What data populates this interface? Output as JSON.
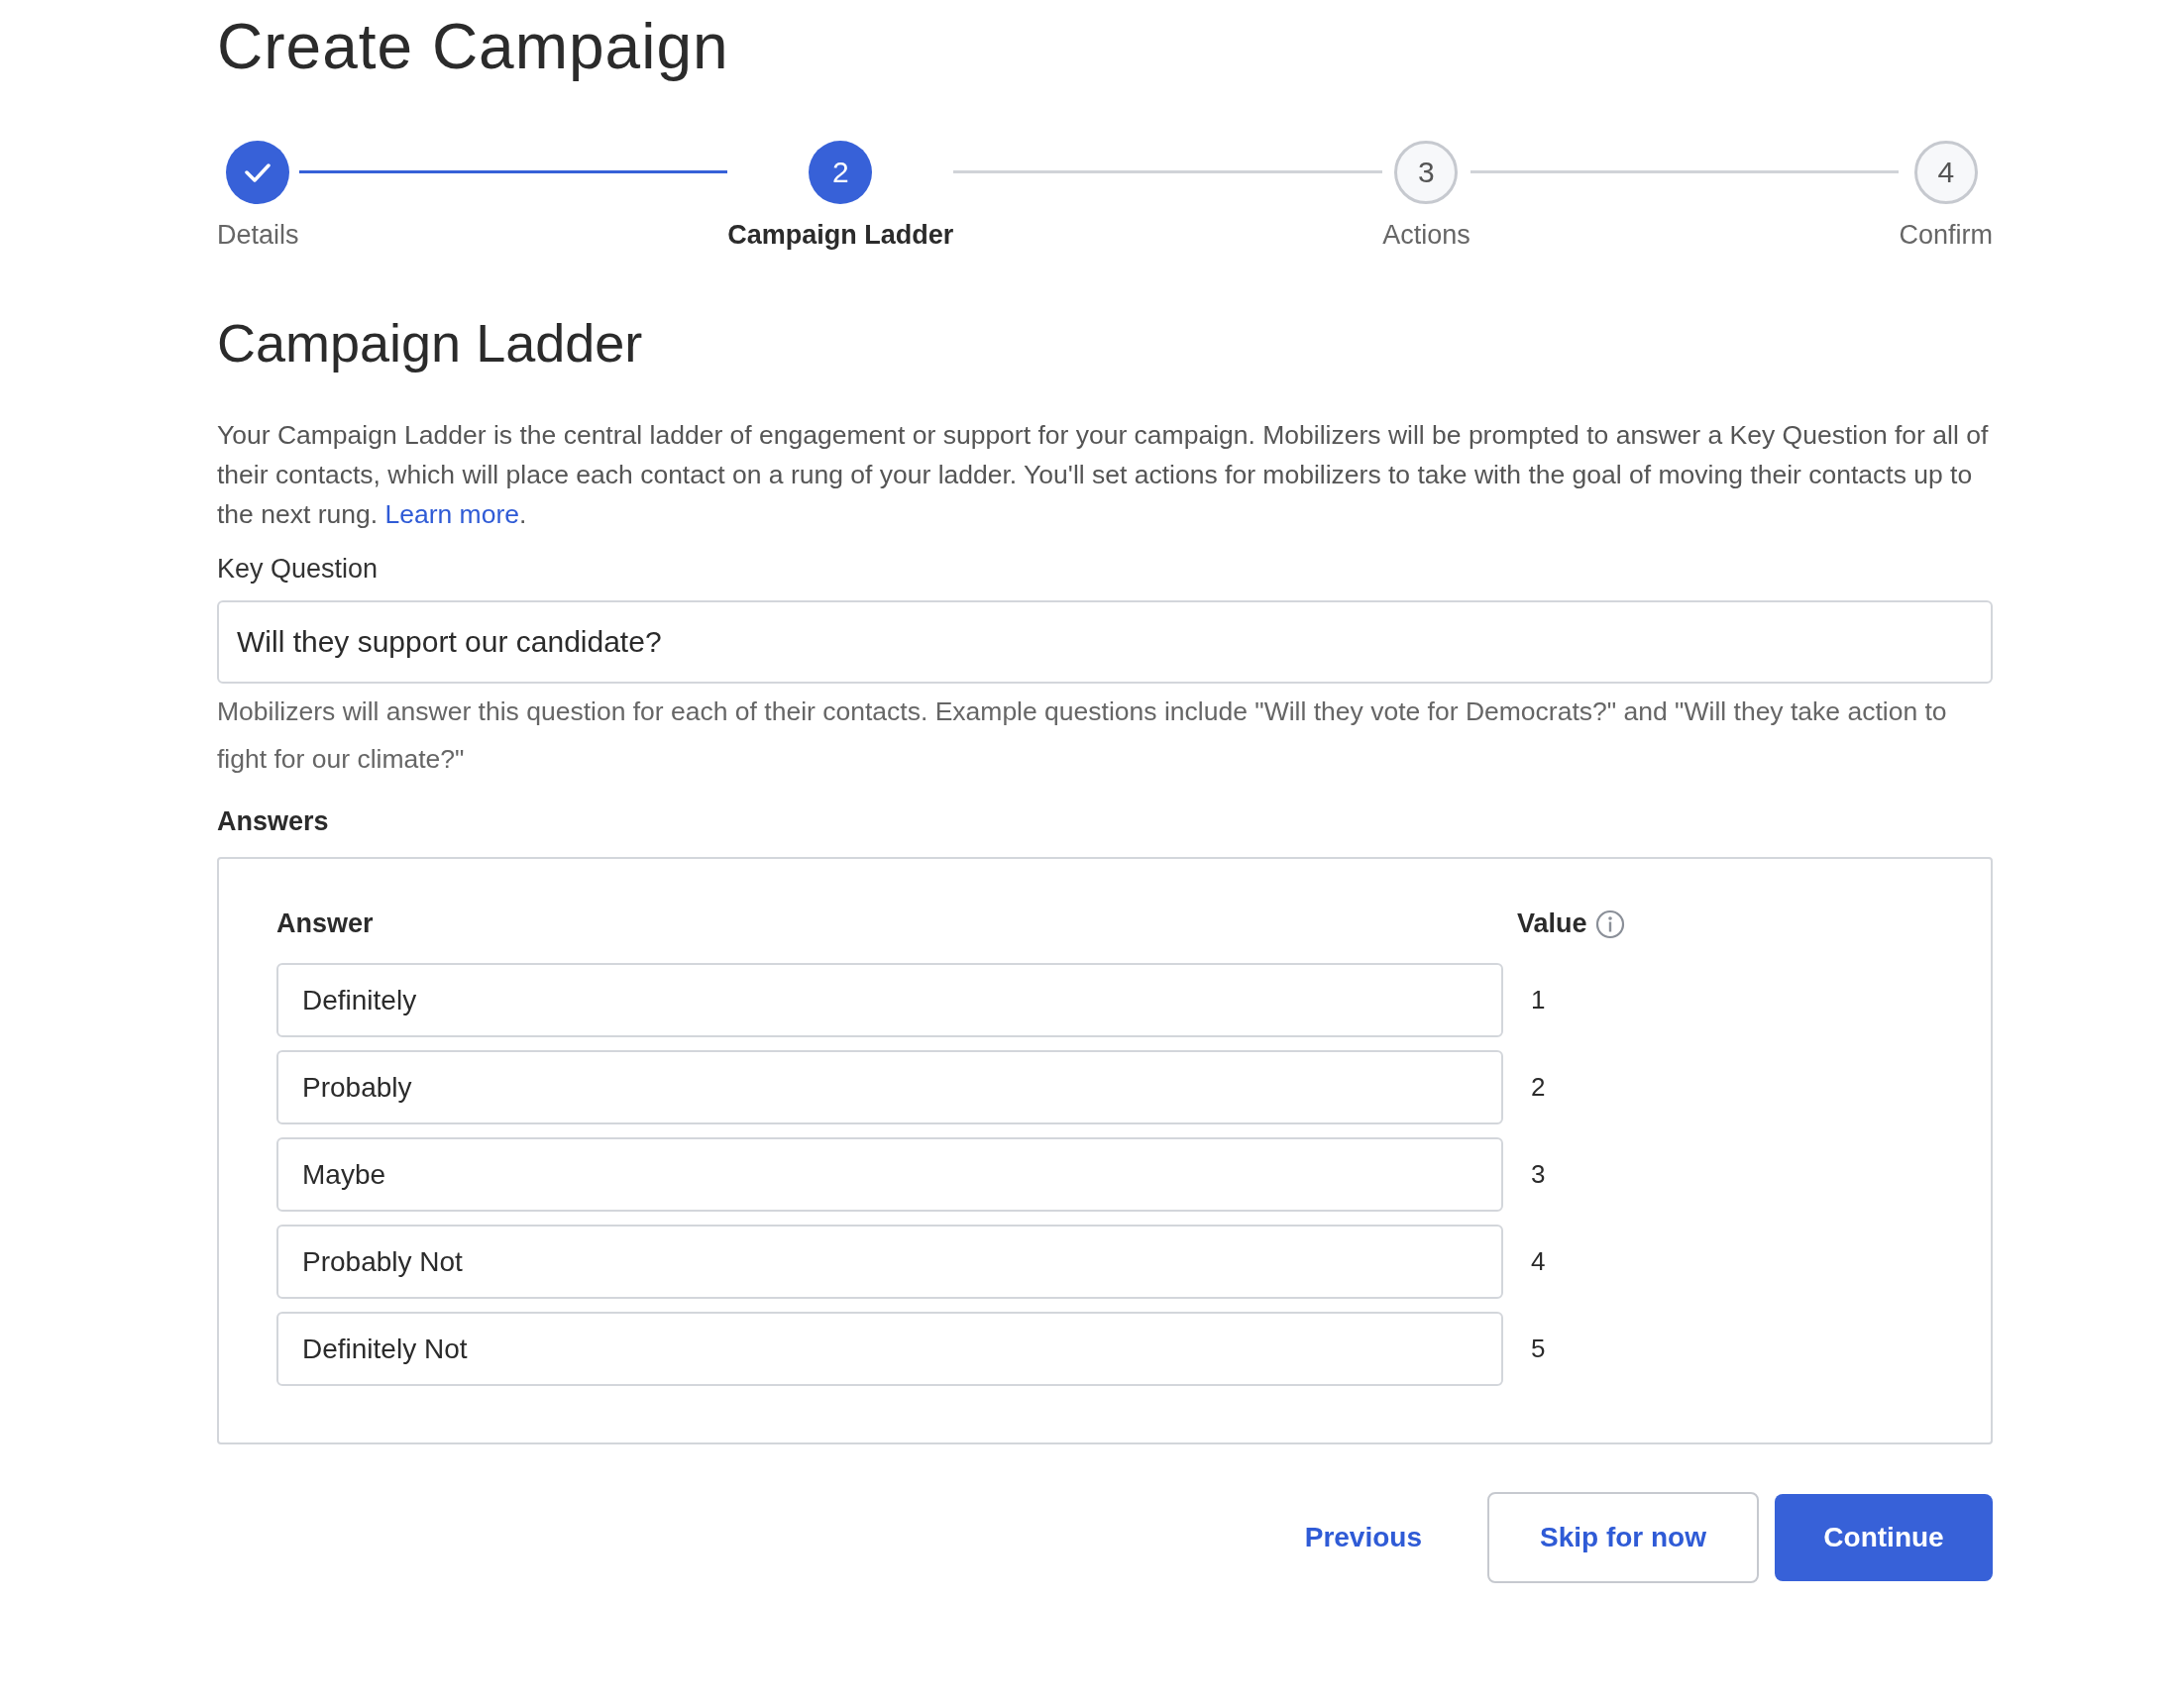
{
  "page_title": "Create Campaign",
  "steps": [
    {
      "label": "Details",
      "completed": true,
      "selected": false
    },
    {
      "label": "Campaign Ladder",
      "number": "2",
      "completed": false,
      "selected": true
    },
    {
      "label": "Actions",
      "number": "3",
      "completed": false,
      "selected": false
    },
    {
      "label": "Confirm",
      "number": "4",
      "completed": false,
      "selected": false
    }
  ],
  "section_title": "Campaign Ladder",
  "intro": "Your Campaign Ladder is the central ladder of engagement or support for your campaign. Mobilizers will be prompted to answer a Key Question for all of their contacts, which will place each contact on a rung of your ladder. You'll set actions for mobilizers to take with the goal of moving their contacts up to the next rung.",
  "learn_more": "Learn more",
  "intro_end": ".",
  "key_question": {
    "label": "Key Question",
    "value": "Will they support our candidate?",
    "help": "Mobilizers will answer this question for each of their contacts. Example questions include \"Will they vote for Democrats?\" and \"Will they take action to fight for our climate?\""
  },
  "answers": {
    "title": "Answers",
    "columns": [
      "Answer",
      "Value"
    ],
    "rows": [
      {
        "answer": "Definitely",
        "value": "1"
      },
      {
        "answer": "Probably",
        "value": "2"
      },
      {
        "answer": "Maybe",
        "value": "3"
      },
      {
        "answer": "Probably Not",
        "value": "4"
      },
      {
        "answer": "Definitely Not",
        "value": "5"
      }
    ]
  },
  "buttons": {
    "previous": "Previous",
    "skip": "Skip for now",
    "continue": "Continue"
  }
}
